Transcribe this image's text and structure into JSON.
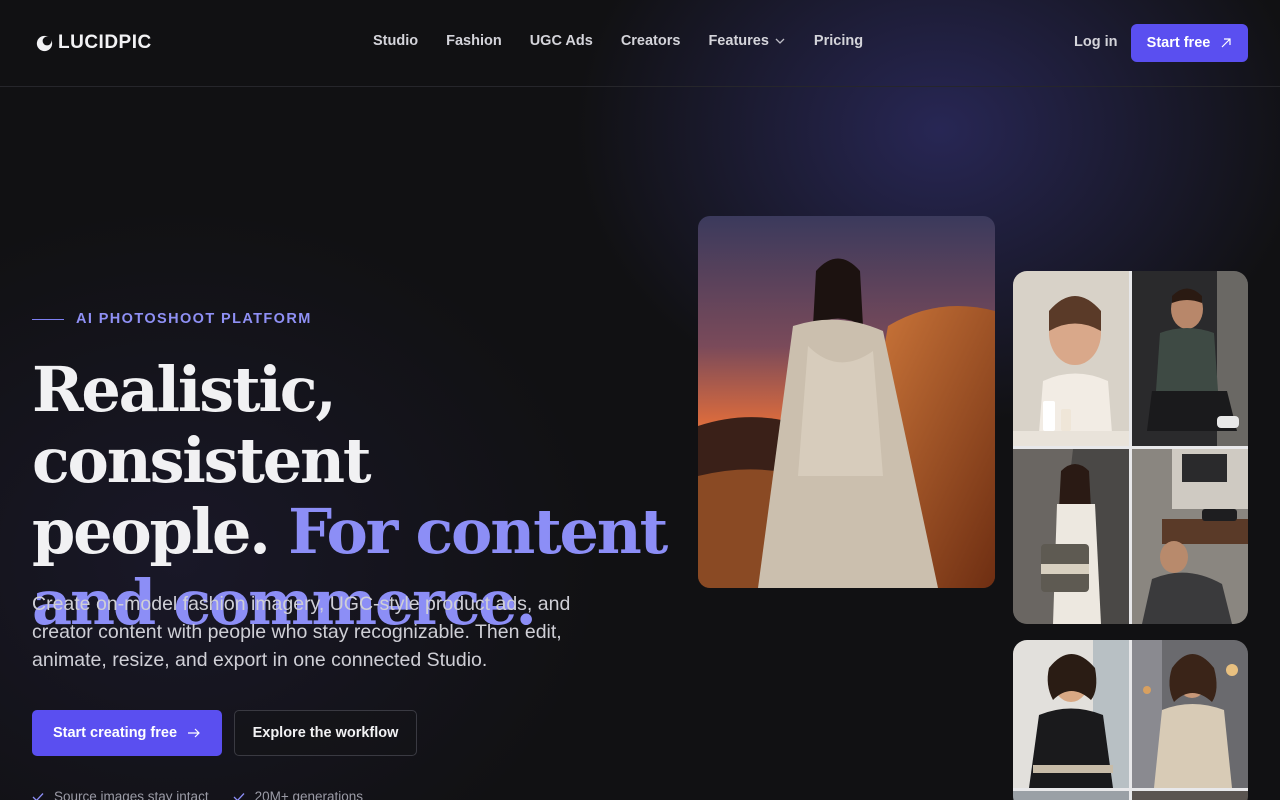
{
  "brand": {
    "name": "LUCIDPIC"
  },
  "nav": {
    "links": [
      "Studio",
      "Fashion",
      "UGC Ads",
      "Creators",
      "Features",
      "Pricing"
    ],
    "login": "Log in",
    "cta": "Start free"
  },
  "hero": {
    "eyebrow": "AI PHOTOSHOOT PLATFORM",
    "headline_line1": "Realistic, consistent",
    "headline_line2a": "people. ",
    "headline_line2b": "For content",
    "headline_line3": "and commerce.",
    "subtext": "Create on-model fashion imagery, UGC-style product ads, and creator content with people who stay recognizable. Then edit, animate, resize, and export in one connected Studio.",
    "primary_cta": "Start creating free",
    "secondary_cta": "Explore the workflow",
    "checks": [
      "Source images stay intact",
      "20M+ generations"
    ]
  },
  "colors": {
    "accent": "#5a4ff0",
    "accent_text": "#8c8ef6",
    "background": "#111113"
  },
  "icons": {
    "logo": "crescent-logo-icon",
    "features_dropdown": "chevron-down-icon",
    "start_free": "arrow-up-right-icon",
    "primary_cta": "arrow-right-icon",
    "checks": "check-icon"
  }
}
